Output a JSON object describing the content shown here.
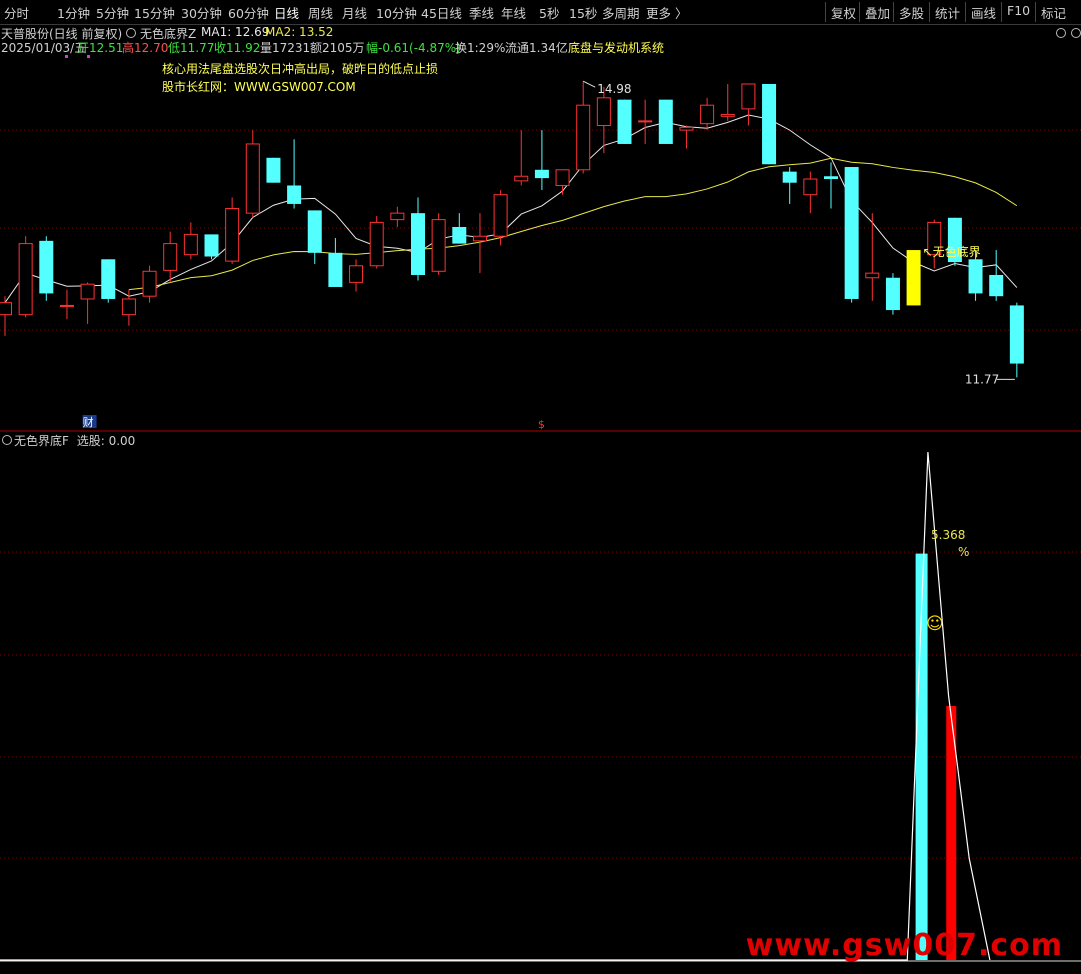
{
  "toolbar": {
    "left_items": [
      "分时",
      "1分钟",
      "5分钟",
      "15分钟",
      "30分钟",
      "60分钟",
      "日线",
      "周线",
      "月线",
      "10分钟",
      "45日线",
      "季线",
      "年线",
      "5秒",
      "15秒",
      "多周期",
      "更多 〉"
    ],
    "active": "日线",
    "right_items": [
      "复权",
      "叠加",
      "多股",
      "统计",
      "画线",
      "F10",
      "标记"
    ]
  },
  "header": {
    "stock": "天普股份(日线 前复权)",
    "indicator": "无色底界Z",
    "ma1": "MA1: 12.69",
    "ma2": "MA2: 13.52",
    "info": {
      "date": "2025/01/03/五",
      "open": "开12.51",
      "high": "高12.70",
      "low": "低11.77",
      "close": "收11.92",
      "vol": "量17231",
      "amount": "额2105万",
      "change": "幅-0.61(-4.87%)",
      "turnover": "换1:29%",
      "float": "流通1.34亿",
      "system": "底盘与发动机系统"
    }
  },
  "notes": {
    "line1": "核心用法尾盘选股次日冲高出局，破昨日的低点止损",
    "line2": "股市长红网：WWW.GSW007.COM"
  },
  "main_chart": {
    "price_range": [
      11.2,
      15.6
    ],
    "high_label": "14.98",
    "low_label": "11.77",
    "signal_label": "↖无色底界",
    "marker_cai": "财",
    "marker_s": "$",
    "colors": {
      "up": "#ff3232",
      "down": "#54ffff",
      "signal": "#ffff00",
      "ma1": "#e8e8e8",
      "ma2": "#e8e84a",
      "grid": "#800000"
    },
    "candles": [
      {
        "o": 12.45,
        "h": 12.65,
        "l": 12.22,
        "c": 12.58
      },
      {
        "o": 12.45,
        "h": 13.3,
        "l": 12.42,
        "c": 13.22
      },
      {
        "o": 13.25,
        "h": 13.3,
        "l": 12.6,
        "c": 12.68
      },
      {
        "o": 12.55,
        "h": 12.72,
        "l": 12.4,
        "c": 12.55
      },
      {
        "o": 12.62,
        "h": 12.8,
        "l": 12.35,
        "c": 12.78
      },
      {
        "o": 13.05,
        "h": 13.05,
        "l": 12.58,
        "c": 12.62
      },
      {
        "o": 12.45,
        "h": 12.72,
        "l": 12.33,
        "c": 12.62
      },
      {
        "o": 12.65,
        "h": 12.98,
        "l": 12.58,
        "c": 12.92
      },
      {
        "o": 12.93,
        "h": 13.35,
        "l": 12.8,
        "c": 13.22
      },
      {
        "o": 13.1,
        "h": 13.45,
        "l": 13.05,
        "c": 13.32
      },
      {
        "o": 13.32,
        "h": 13.25,
        "l": 13.05,
        "c": 13.08
      },
      {
        "o": 13.03,
        "h": 13.72,
        "l": 13.0,
        "c": 13.6
      },
      {
        "o": 13.55,
        "h": 14.45,
        "l": 13.5,
        "c": 14.3
      },
      {
        "o": 14.15,
        "h": 14.15,
        "l": 13.88,
        "c": 13.88
      },
      {
        "o": 13.85,
        "h": 14.35,
        "l": 13.6,
        "c": 13.65
      },
      {
        "o": 13.58,
        "h": 13.58,
        "l": 13.0,
        "c": 13.12
      },
      {
        "o": 13.12,
        "h": 13.28,
        "l": 12.78,
        "c": 12.75
      },
      {
        "o": 12.8,
        "h": 13.05,
        "l": 12.7,
        "c": 12.98
      },
      {
        "o": 12.98,
        "h": 13.52,
        "l": 12.95,
        "c": 13.45
      },
      {
        "o": 13.48,
        "h": 13.62,
        "l": 13.4,
        "c": 13.55
      },
      {
        "o": 13.55,
        "h": 13.72,
        "l": 12.82,
        "c": 12.88
      },
      {
        "o": 12.92,
        "h": 13.55,
        "l": 12.88,
        "c": 13.48
      },
      {
        "o": 13.4,
        "h": 13.55,
        "l": 13.22,
        "c": 13.22
      },
      {
        "o": 13.25,
        "h": 13.55,
        "l": 12.9,
        "c": 13.3
      },
      {
        "o": 13.3,
        "h": 13.8,
        "l": 13.2,
        "c": 13.75
      },
      {
        "o": 13.9,
        "h": 14.45,
        "l": 13.85,
        "c": 13.95
      },
      {
        "o": 14.02,
        "h": 14.45,
        "l": 13.8,
        "c": 13.93
      },
      {
        "o": 13.85,
        "h": 14.0,
        "l": 13.75,
        "c": 14.02
      },
      {
        "o": 14.02,
        "h": 14.98,
        "l": 13.98,
        "c": 14.72
      },
      {
        "o": 14.5,
        "h": 14.92,
        "l": 14.2,
        "c": 14.8
      },
      {
        "o": 14.78,
        "h": 14.78,
        "l": 14.3,
        "c": 14.3
      },
      {
        "o": 14.55,
        "h": 14.78,
        "l": 14.3,
        "c": 14.55
      },
      {
        "o": 14.78,
        "h": 14.78,
        "l": 14.3,
        "c": 14.3
      },
      {
        "o": 14.45,
        "h": 14.5,
        "l": 14.25,
        "c": 14.48
      },
      {
        "o": 14.52,
        "h": 14.8,
        "l": 14.45,
        "c": 14.72
      },
      {
        "o": 14.6,
        "h": 14.95,
        "l": 14.55,
        "c": 14.62
      },
      {
        "o": 14.68,
        "h": 14.92,
        "l": 14.5,
        "c": 14.95
      },
      {
        "o": 14.95,
        "h": 14.95,
        "l": 14.08,
        "c": 14.08
      },
      {
        "o": 14.0,
        "h": 14.05,
        "l": 13.65,
        "c": 13.88
      },
      {
        "o": 13.75,
        "h": 14.0,
        "l": 13.55,
        "c": 13.92
      },
      {
        "o": 13.95,
        "h": 14.1,
        "l": 13.6,
        "c": 13.92
      },
      {
        "o": 14.05,
        "h": 14.05,
        "l": 12.58,
        "c": 12.62
      },
      {
        "o": 12.85,
        "h": 13.55,
        "l": 12.6,
        "c": 12.9
      },
      {
        "o": 12.85,
        "h": 12.9,
        "l": 12.45,
        "c": 12.5
      },
      {
        "o": 12.55,
        "h": 13.15,
        "l": 12.55,
        "c": 13.15,
        "sig": true
      },
      {
        "o": 13.1,
        "h": 13.48,
        "l": 12.95,
        "c": 13.45
      },
      {
        "o": 13.5,
        "h": 13.5,
        "l": 12.98,
        "c": 13.02
      },
      {
        "o": 13.05,
        "h": 13.15,
        "l": 12.6,
        "c": 12.68
      },
      {
        "o": 12.88,
        "h": 13.15,
        "l": 12.6,
        "c": 12.65
      },
      {
        "o": 12.55,
        "h": 12.58,
        "l": 11.77,
        "c": 11.92
      }
    ]
  },
  "sub_chart": {
    "title": "无色界底F",
    "pick": "选股: 0.00",
    "pct_value": "5.368",
    "pct_sign": "%",
    "smile": "☺",
    "colors": {
      "cyan": "#54ffff",
      "red": "#ff0000",
      "line": "#ffffff",
      "grid": "#800000"
    },
    "line_x": [
      0,
      44,
      45,
      46,
      47,
      48
    ],
    "line_y": [
      0,
      0,
      100,
      52,
      20,
      0
    ],
    "cyan_bar": 80,
    "red_bar": 50
  },
  "watermark": "www.gsw007.com"
}
